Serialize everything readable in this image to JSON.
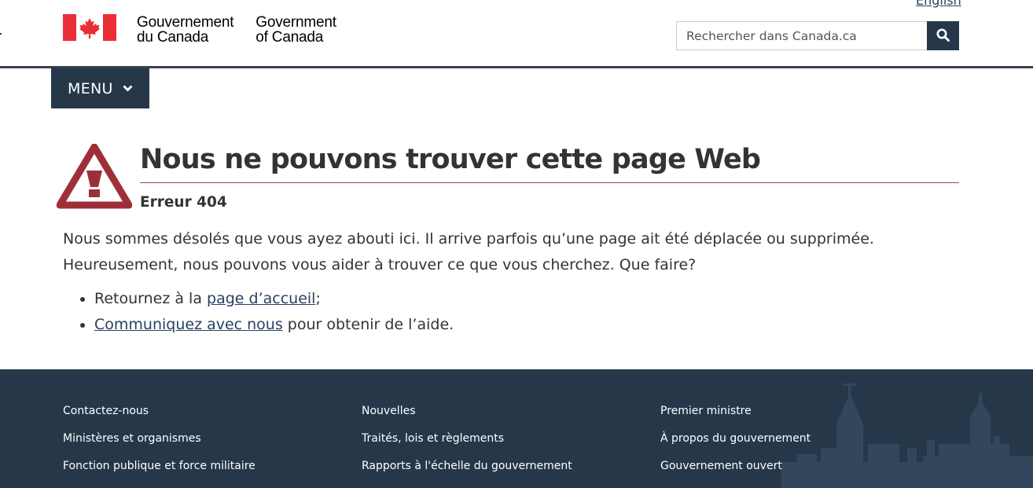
{
  "header": {
    "language_link": "English",
    "signature_fr": [
      "Gouvernement",
      "du Canada"
    ],
    "signature_en": [
      "Government",
      "of Canada"
    ],
    "search": {
      "placeholder": "Rechercher dans Canada.ca"
    }
  },
  "menu": {
    "label": "MENU"
  },
  "main": {
    "title": "Nous ne pouvons trouver cette page Web",
    "error_code": "Erreur 404",
    "paragraph_line1": "Nous sommes désolés que vous ayez abouti ici. Il arrive parfois qu’une page ait été déplacée ou supprimée.",
    "paragraph_line2": "Heureusement, nous pouvons vous aider à trouver ce que vous cherchez. Que faire?",
    "options": [
      {
        "before": "Retournez à la ",
        "link": "page d’accueil",
        "after": ";"
      },
      {
        "before": "",
        "link": "Communiquez avec nous",
        "after": " pour obtenir de l’aide."
      }
    ]
  },
  "footer": {
    "columns": [
      [
        "Contactez-nous",
        "Ministères et organismes",
        "Fonction publique et force militaire"
      ],
      [
        "Nouvelles",
        "Traités, lois et règlements",
        "Rapports à l'échelle du gouvernement"
      ],
      [
        "Premier ministre",
        "À propos du gouvernement",
        "Gouvernement ouvert"
      ]
    ]
  },
  "colors": {
    "accent_dark": "#26374a",
    "flag_red": "#eb2d37",
    "alert_red": "#9e2f38",
    "link": "#284162"
  }
}
